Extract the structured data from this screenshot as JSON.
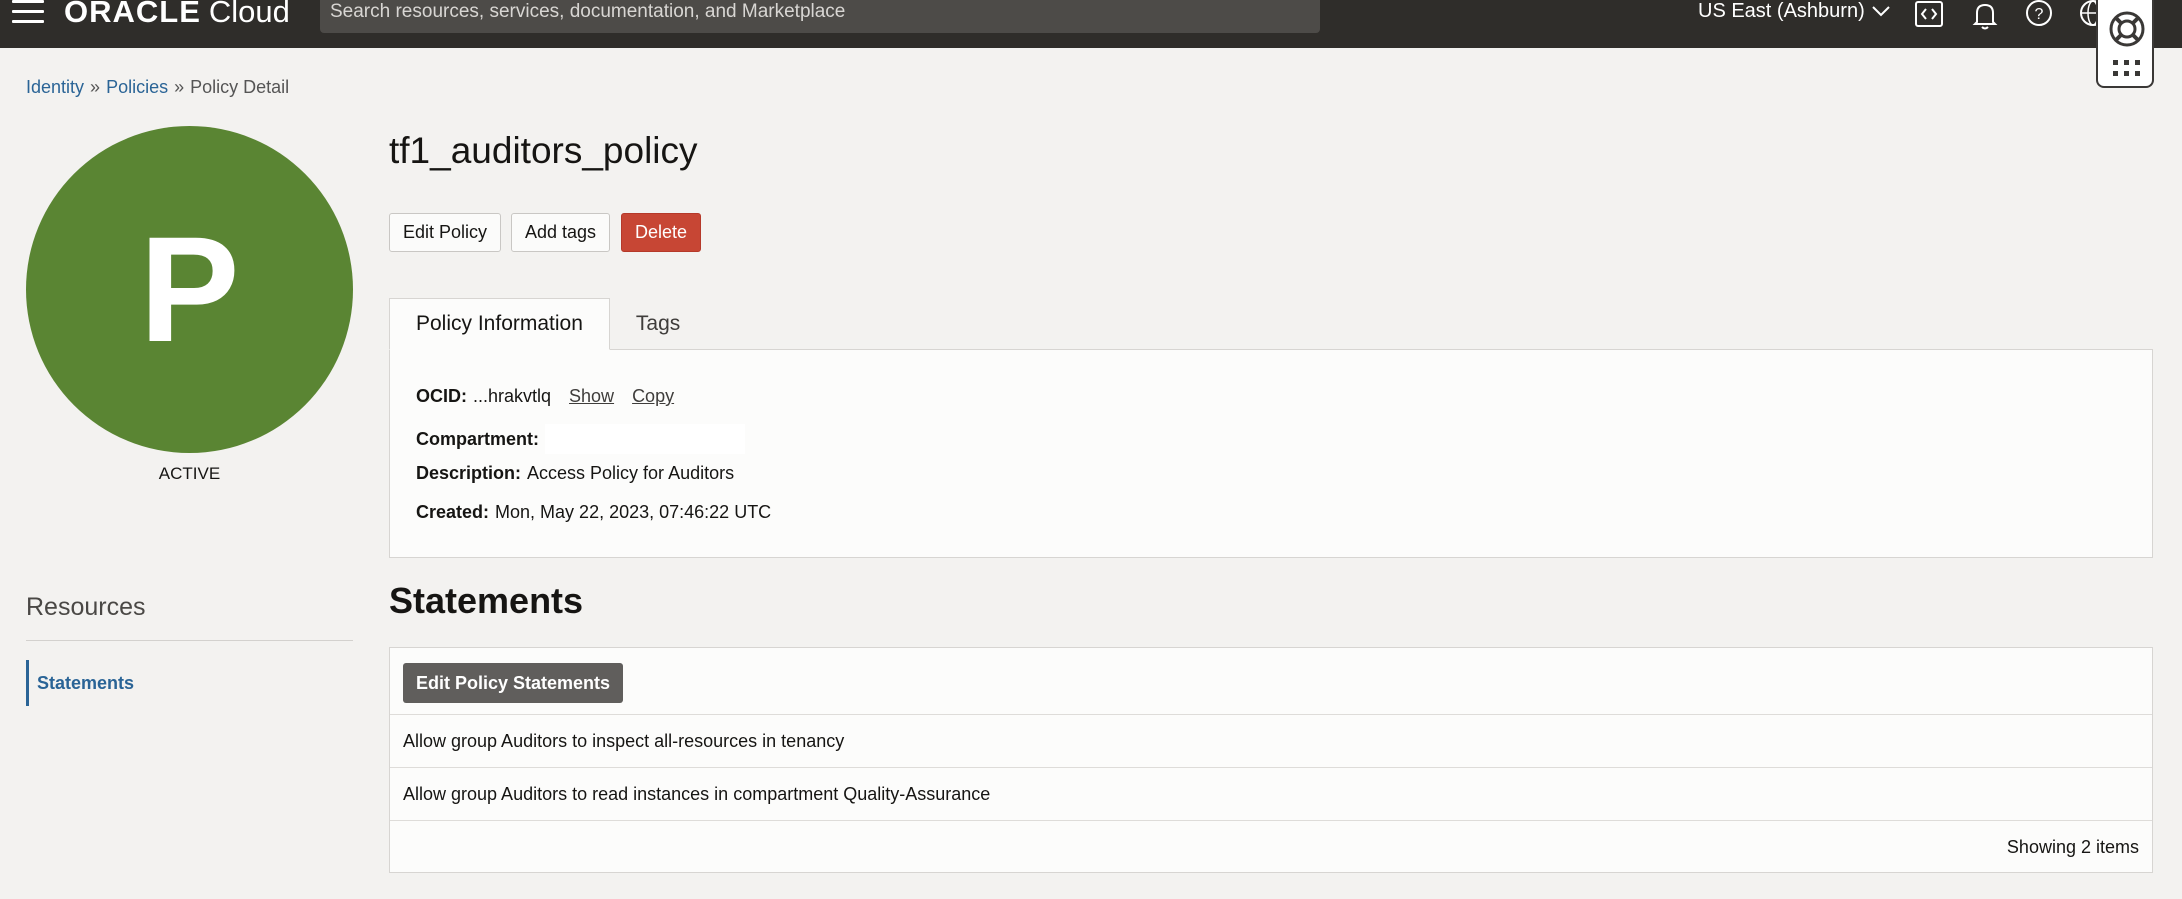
{
  "header": {
    "logo_brand": "ORACLE",
    "logo_product": "Cloud",
    "search_placeholder": "Search resources, services, documentation, and Marketplace",
    "region": "US East (Ashburn)",
    "icons": [
      "menu-icon",
      "code-editor-icon",
      "bell-icon",
      "help-icon",
      "globe-icon",
      "lifebuoy-icon",
      "apps-grid-icon"
    ]
  },
  "breadcrumb": [
    {
      "label": "Identity"
    },
    {
      "label": "Policies"
    },
    {
      "label": "Policy Detail"
    }
  ],
  "breadcrumb_separator": "»",
  "avatar": {
    "letter": "P",
    "color": "#5a8533",
    "status": "ACTIVE"
  },
  "resources": {
    "title": "Resources",
    "items": [
      "Statements"
    ]
  },
  "policy": {
    "name": "tf1_auditors_policy",
    "actions": {
      "edit": "Edit Policy",
      "add_tags": "Add tags",
      "delete": "Delete"
    },
    "tabs": [
      "Policy Information",
      "Tags"
    ],
    "info": {
      "ocid_label": "OCID:",
      "ocid_value": "...hrakvtlq",
      "show": "Show",
      "copy": "Copy",
      "compartment_label": "Compartment:",
      "compartment_value": "",
      "description_label": "Description:",
      "description_value": "Access Policy for Auditors",
      "created_label": "Created:",
      "created_value": "Mon, May 22, 2023, 07:46:22 UTC"
    }
  },
  "statements": {
    "title": "Statements",
    "edit_button": "Edit Policy Statements",
    "rows": [
      "Allow group Auditors to inspect all-resources in tenancy",
      "Allow group Auditors to read instances in compartment Quality-Assurance"
    ],
    "footer": "Showing 2 items"
  },
  "colors": {
    "topbar": "#2f2d2a",
    "delete": "#c74634",
    "link": "#2a6496",
    "accent_green": "#5a8533"
  }
}
